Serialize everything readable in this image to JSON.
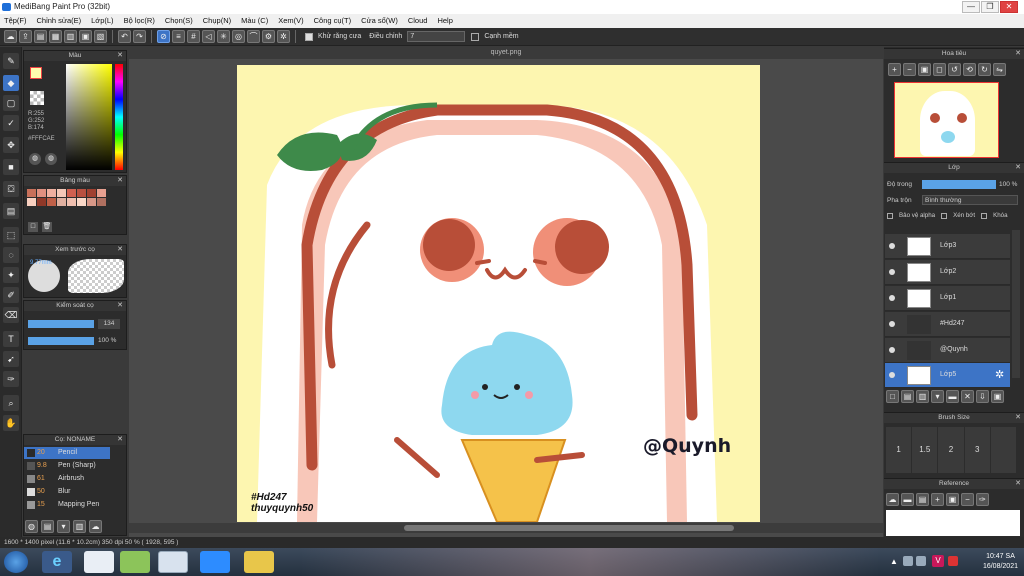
{
  "window": {
    "title": "MediBang Paint Pro (32bit)",
    "minimize": "—",
    "restore": "❐",
    "close": "✕"
  },
  "menu": [
    "Tệp(F)",
    "Chỉnh sửa(E)",
    "Lớp(L)",
    "Bộ lọc(R)",
    "Chọn(S)",
    "Chụp(N)",
    "Màu (C)",
    "Xem(V)",
    "Công cụ(T)",
    "Cửa sổ(W)",
    "Cloud",
    "Help"
  ],
  "toolbar": {
    "antialias_label": "Khử răng cưa",
    "adjust_label": "Điều chỉnh",
    "adjust_value": "7",
    "edge_label": "Cạnh mềm"
  },
  "color_panel": {
    "title": "Màu",
    "r": "R:255",
    "g": "G:252",
    "b": "B:174",
    "hex": "#FFFCAE",
    "fg_color": "#fffcae",
    "bg_color": "#ffffff"
  },
  "palette_panel": {
    "title": "Bảng màu",
    "swatches": [
      "#c8705a",
      "#e09080",
      "#f0b0a0",
      "#f4c8b8",
      "#d06050",
      "#b85040",
      "#a04030",
      "#e8a090",
      "#f8d0c0",
      "#903828",
      "#c06048",
      "#e0b0a0",
      "#f0c0b0",
      "#fad8c8",
      "#d89888",
      "#b07060"
    ]
  },
  "preview_panel": {
    "title": "Xem trước cọ",
    "size": "9.77mm"
  },
  "control_panel": {
    "title": "Kiểm soát cọ",
    "size_value": "134",
    "opacity_value": "100 %"
  },
  "brush_panel": {
    "title": "Cọ: NONAME",
    "items": [
      {
        "size": "20",
        "name": "Pencil",
        "color": "#2a2a2a"
      },
      {
        "size": "9.8",
        "name": "Pen (Sharp)",
        "color": "#555555"
      },
      {
        "size": "61",
        "name": "Airbrush",
        "color": "#888888"
      },
      {
        "size": "50",
        "name": "Blur",
        "color": "#dddddd"
      },
      {
        "size": "15",
        "name": "Mapping Pen",
        "color": "#999999"
      }
    ]
  },
  "document": {
    "tab": "quyet.png",
    "signature": "@Quynh",
    "tag_line1": "#Hd247",
    "tag_line2": "thuyquynh50"
  },
  "navigator": {
    "title": "Hoa tiêu"
  },
  "layer_panel": {
    "title": "Lớp",
    "opacity_label": "Độ trong",
    "opacity_value": "100 %",
    "blend_label": "Pha trộn",
    "blend_value": "Bình thường",
    "protect_alpha": "Bảo vệ alpha",
    "clipping": "Xén bớt",
    "lock": "Khóa",
    "layers": [
      {
        "name": "Lớp3"
      },
      {
        "name": "Lớp2"
      },
      {
        "name": "Lớp1"
      },
      {
        "name": "#Hd247"
      },
      {
        "name": "@Quynh"
      },
      {
        "name": "Lớp5"
      }
    ]
  },
  "brush_size_panel": {
    "title": "Brush Size",
    "sizes": [
      "1",
      "1.5",
      "2",
      "3"
    ]
  },
  "reference_panel": {
    "title": "Reference"
  },
  "status": {
    "text": "1600 * 1400 pixel  (11.6 * 10.2cm)  350 dpi  50 %  ( 1928, 595 )"
  },
  "taskbar": {
    "time": "10:47 SA",
    "date": "16/08/2021"
  }
}
